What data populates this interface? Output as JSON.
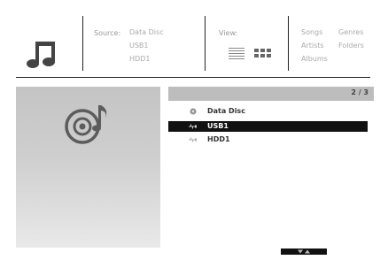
{
  "header": {
    "source": {
      "label": "Source:",
      "options": [
        "Data Disc",
        "USB1",
        "HDD1"
      ]
    },
    "view": {
      "label": "View:"
    },
    "categories": {
      "col1": [
        "Songs",
        "Artists",
        "Albums"
      ],
      "col2": [
        "Genres",
        "Folders"
      ]
    }
  },
  "list": {
    "page_indicator": "2 / 3",
    "items": [
      {
        "label": "Data Disc",
        "icon": "disc-icon",
        "selected": false
      },
      {
        "label": "USB1",
        "icon": "usb-icon",
        "selected": true
      },
      {
        "label": "HDD1",
        "icon": "usb-icon",
        "selected": false
      }
    ]
  },
  "icons": {
    "app": "music-note-icon",
    "preview": "music-disc-icon",
    "scroll": "chevron-up-down-icon"
  },
  "colors": {
    "selected_row": "#111111",
    "header_bar": "#bdbdbd",
    "divider": "#222222"
  }
}
